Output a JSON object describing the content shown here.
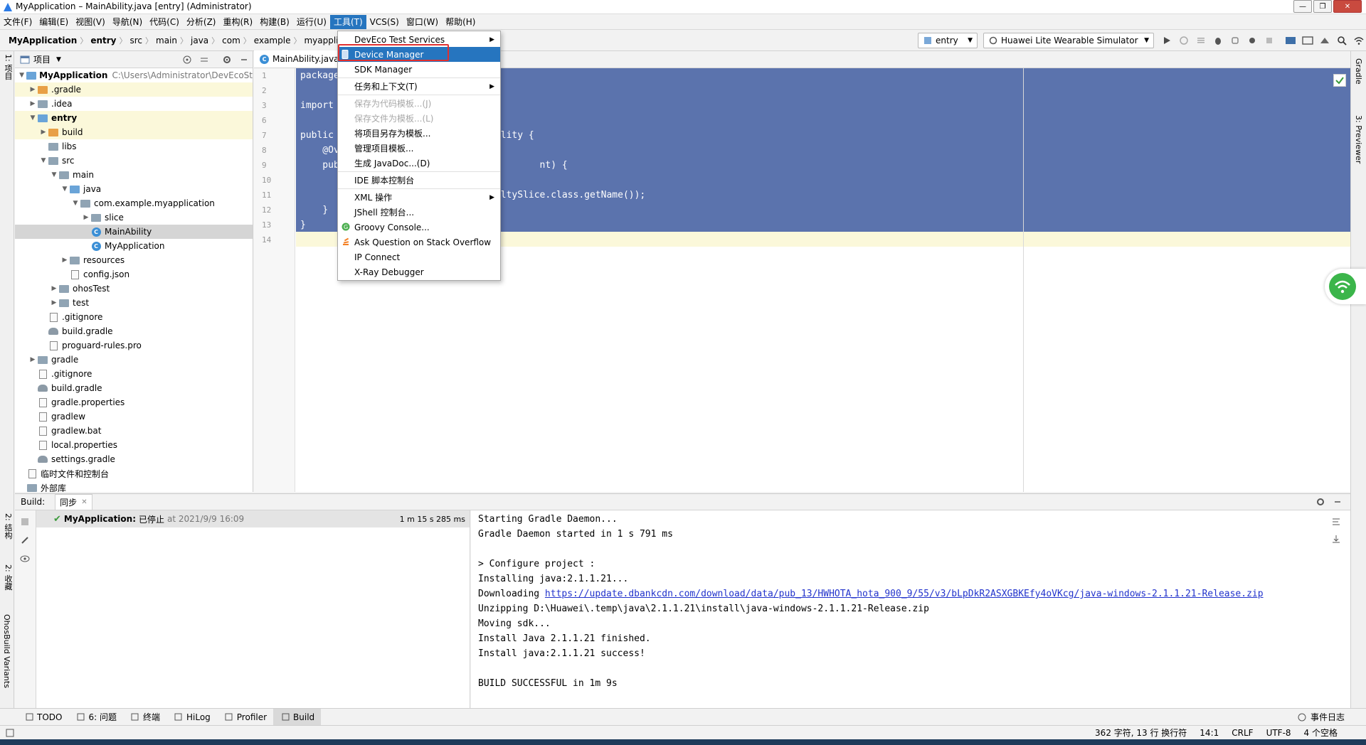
{
  "window": {
    "title": "MyApplication – MainAbility.java [entry] (Administrator)"
  },
  "menubar": {
    "items": [
      "文件(F)",
      "编辑(E)",
      "视图(V)",
      "导航(N)",
      "代码(C)",
      "分析(Z)",
      "重构(R)",
      "构建(B)",
      "运行(U)",
      "工具(T)",
      "VCS(S)",
      "窗口(W)",
      "帮助(H)"
    ],
    "active_index": 9
  },
  "breadcrumb": [
    "MyApplication",
    "entry",
    "src",
    "main",
    "java",
    "com",
    "example",
    "myapplication"
  ],
  "toolbar": {
    "module_combo": "entry",
    "device_combo": "Huawei Lite Wearable Simulator"
  },
  "project_panel": {
    "header": "项目",
    "items": [
      {
        "label": "MyApplication",
        "extra": "C:\\Users\\Administrator\\DevEcoSt",
        "kind": "module",
        "depth": 0,
        "arrow": "down",
        "bold": true
      },
      {
        "label": ".gradle",
        "kind": "folder-orange",
        "depth": 1,
        "arrow": "right",
        "hl": true
      },
      {
        "label": ".idea",
        "kind": "folder",
        "depth": 1,
        "arrow": "right"
      },
      {
        "label": "entry",
        "kind": "module",
        "depth": 1,
        "arrow": "down",
        "bold": true,
        "hl": true
      },
      {
        "label": "build",
        "kind": "folder-orange",
        "depth": 2,
        "arrow": "right",
        "hl": true
      },
      {
        "label": "libs",
        "kind": "folder",
        "depth": 2,
        "arrow": ""
      },
      {
        "label": "src",
        "kind": "folder",
        "depth": 2,
        "arrow": "down"
      },
      {
        "label": "main",
        "kind": "folder",
        "depth": 3,
        "arrow": "down"
      },
      {
        "label": "java",
        "kind": "folder-blue",
        "depth": 4,
        "arrow": "down"
      },
      {
        "label": "com.example.myapplication",
        "kind": "folder",
        "depth": 5,
        "arrow": "down"
      },
      {
        "label": "slice",
        "kind": "folder",
        "depth": 6,
        "arrow": "right"
      },
      {
        "label": "MainAbility",
        "kind": "class",
        "depth": 6,
        "arrow": "",
        "selected": true
      },
      {
        "label": "MyApplication",
        "kind": "class",
        "depth": 6,
        "arrow": ""
      },
      {
        "label": "resources",
        "kind": "folder",
        "depth": 4,
        "arrow": "right"
      },
      {
        "label": "config.json",
        "kind": "file",
        "depth": 4,
        "arrow": ""
      },
      {
        "label": "ohosTest",
        "kind": "folder",
        "depth": 3,
        "arrow": "right"
      },
      {
        "label": "test",
        "kind": "folder",
        "depth": 3,
        "arrow": "right"
      },
      {
        "label": ".gitignore",
        "kind": "file",
        "depth": 2,
        "arrow": ""
      },
      {
        "label": "build.gradle",
        "kind": "gradle",
        "depth": 2,
        "arrow": ""
      },
      {
        "label": "proguard-rules.pro",
        "kind": "file",
        "depth": 2,
        "arrow": ""
      },
      {
        "label": "gradle",
        "kind": "folder",
        "depth": 1,
        "arrow": "right"
      },
      {
        "label": ".gitignore",
        "kind": "file",
        "depth": 1,
        "arrow": ""
      },
      {
        "label": "build.gradle",
        "kind": "gradle",
        "depth": 1,
        "arrow": ""
      },
      {
        "label": "gradle.properties",
        "kind": "file",
        "depth": 1,
        "arrow": ""
      },
      {
        "label": "gradlew",
        "kind": "file",
        "depth": 1,
        "arrow": ""
      },
      {
        "label": "gradlew.bat",
        "kind": "file",
        "depth": 1,
        "arrow": ""
      },
      {
        "label": "local.properties",
        "kind": "file",
        "depth": 1,
        "arrow": ""
      },
      {
        "label": "settings.gradle",
        "kind": "gradle",
        "depth": 1,
        "arrow": ""
      },
      {
        "label": "临时文件和控制台",
        "kind": "scratch",
        "depth": 0,
        "arrow": ""
      },
      {
        "label": "外部库",
        "kind": "folder",
        "depth": 0,
        "arrow": ""
      }
    ]
  },
  "editor": {
    "tab": "MainAbility.java",
    "line_numbers": [
      "1",
      "2",
      "3",
      "6",
      "7",
      "8",
      "9",
      "10",
      "11",
      "12",
      "13",
      "14"
    ],
    "code_lines": [
      "package",
      "",
      "import",
      "",
      "public                              lity {",
      "    @Ov",
      "    pub                                    nt) {",
      "      ",
      "                                    ltySlice.class.getName());",
      "    }",
      "}",
      ""
    ]
  },
  "tools_menu": {
    "items": [
      {
        "label": "DevEco Test Services",
        "submenu": true
      },
      {
        "label": "Device Manager",
        "selected": true,
        "icon": "phone-icon"
      },
      {
        "label": "SDK Manager"
      },
      {
        "sep": true
      },
      {
        "label": "任务和上下文(T)",
        "submenu": true
      },
      {
        "sep": true
      },
      {
        "label": "保存为代码模板...(J)",
        "disabled": true
      },
      {
        "label": "保存文件为模板...(L)",
        "disabled": true
      },
      {
        "label": "将项目另存为模板..."
      },
      {
        "label": "管理项目模板..."
      },
      {
        "label": "生成 JavaDoc...(D)"
      },
      {
        "sep": true
      },
      {
        "label": "IDE 脚本控制台"
      },
      {
        "sep": true
      },
      {
        "label": "XML 操作",
        "submenu": true
      },
      {
        "label": "JShell 控制台..."
      },
      {
        "label": "Groovy Console...",
        "icon": "groovy-icon"
      },
      {
        "label": "Ask Question on Stack Overflow",
        "icon": "stackoverflow-icon"
      },
      {
        "label": "IP Connect"
      },
      {
        "label": "X-Ray Debugger"
      }
    ]
  },
  "build_panel": {
    "label": "Build:",
    "tab": "同步",
    "tree_item": {
      "name": "MyApplication:",
      "status": "已停止",
      "at": "at 2021/9/9 16:09",
      "duration": "1 m 15 s 285 ms"
    },
    "console": [
      {
        "text": "Starting Gradle Daemon..."
      },
      {
        "text": "Gradle Daemon started in 1 s 791 ms"
      },
      {
        "text": ""
      },
      {
        "text": "> Configure project :"
      },
      {
        "text": "Installing java:2.1.1.21..."
      },
      {
        "text": "Downloading ",
        "link": "https://update.dbankcdn.com/download/data/pub_13/HWHOTA_hota_900_9/55/v3/bLpDkR2ASXGBKEfy4oVKcg/java-windows-2.1.1.21-Release.zip"
      },
      {
        "text": "Unzipping D:\\Huawei\\.temp\\java\\2.1.1.21\\install\\java-windows-2.1.1.21-Release.zip"
      },
      {
        "text": "Moving sdk..."
      },
      {
        "text": "Install Java 2.1.1.21 finished."
      },
      {
        "text": "Install java:2.1.1.21 success!"
      },
      {
        "text": ""
      },
      {
        "text": "BUILD SUCCESSFUL in 1m 9s"
      }
    ]
  },
  "tool_tabs": [
    "TODO",
    "6: 问题",
    "终端",
    "HiLog",
    "Profiler",
    "Build"
  ],
  "event_log": "事件日志",
  "status_bar": [
    "362 字符, 13 行 换行符",
    "14:1",
    "CRLF",
    "UTF-8",
    "4 个空格"
  ],
  "left_stripe": [
    "1: 项目",
    "2: 结构",
    "2: 收藏",
    "OhosBuild Variants"
  ],
  "right_stripe": [
    "Gradle",
    "3: Previewer"
  ],
  "colors": {
    "selection": "#5b73ad",
    "menu_highlight": "#2675bf",
    "red_box": "#e03030",
    "link": "#2233cc"
  }
}
